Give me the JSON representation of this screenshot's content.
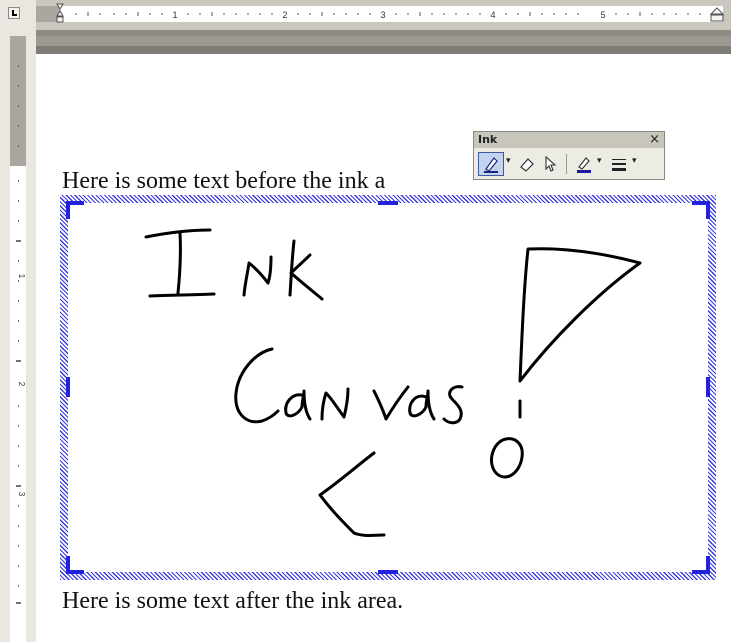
{
  "rulers": {
    "horizontal_numbers": [
      "1",
      "2",
      "3",
      "4",
      "5"
    ],
    "vertical_numbers": [
      "1",
      "2",
      "3"
    ]
  },
  "document": {
    "text_before": "Here is some text before the ink a",
    "text_after": "Here is some text after the ink area."
  },
  "ink_toolbar": {
    "title": "Ink",
    "close_glyph": "×",
    "buttons": [
      {
        "icon": "pen-icon",
        "active": true
      },
      {
        "icon": "eraser-icon",
        "active": false
      },
      {
        "icon": "select-arrow-icon",
        "active": false
      },
      {
        "icon": "ink-color-icon",
        "active": false
      },
      {
        "icon": "line-style-icon",
        "active": false
      }
    ]
  },
  "colors": {
    "canvas_border": "#3a3ae0",
    "handle": "#2222dd",
    "ink": "#000000",
    "toolbar_bg": "#ecebe4",
    "pen_active": "#c2d4f0"
  }
}
